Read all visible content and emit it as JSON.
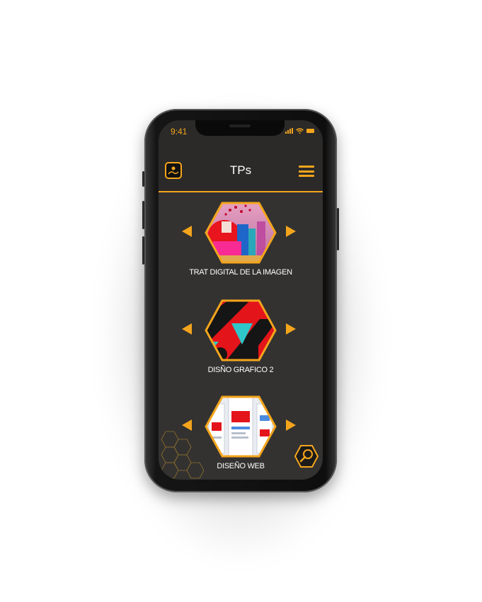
{
  "status_bar": {
    "time": "9:41"
  },
  "header": {
    "title": "TPs"
  },
  "colors": {
    "accent": "#f4a51c",
    "background": "#333231",
    "header": "#2b2a29",
    "text": "#ffffff"
  },
  "projects": [
    {
      "label": "TRAT DIGITAL DE LA IMAGEN"
    },
    {
      "label": "DISÑO GRAFICO 2"
    },
    {
      "label": "DISEÑO WEB"
    }
  ],
  "icons": [
    "logo-icon",
    "menu-icon",
    "arrow-left-icon",
    "arrow-right-icon",
    "search-icon",
    "signal-icon",
    "wifi-icon",
    "battery-icon"
  ]
}
